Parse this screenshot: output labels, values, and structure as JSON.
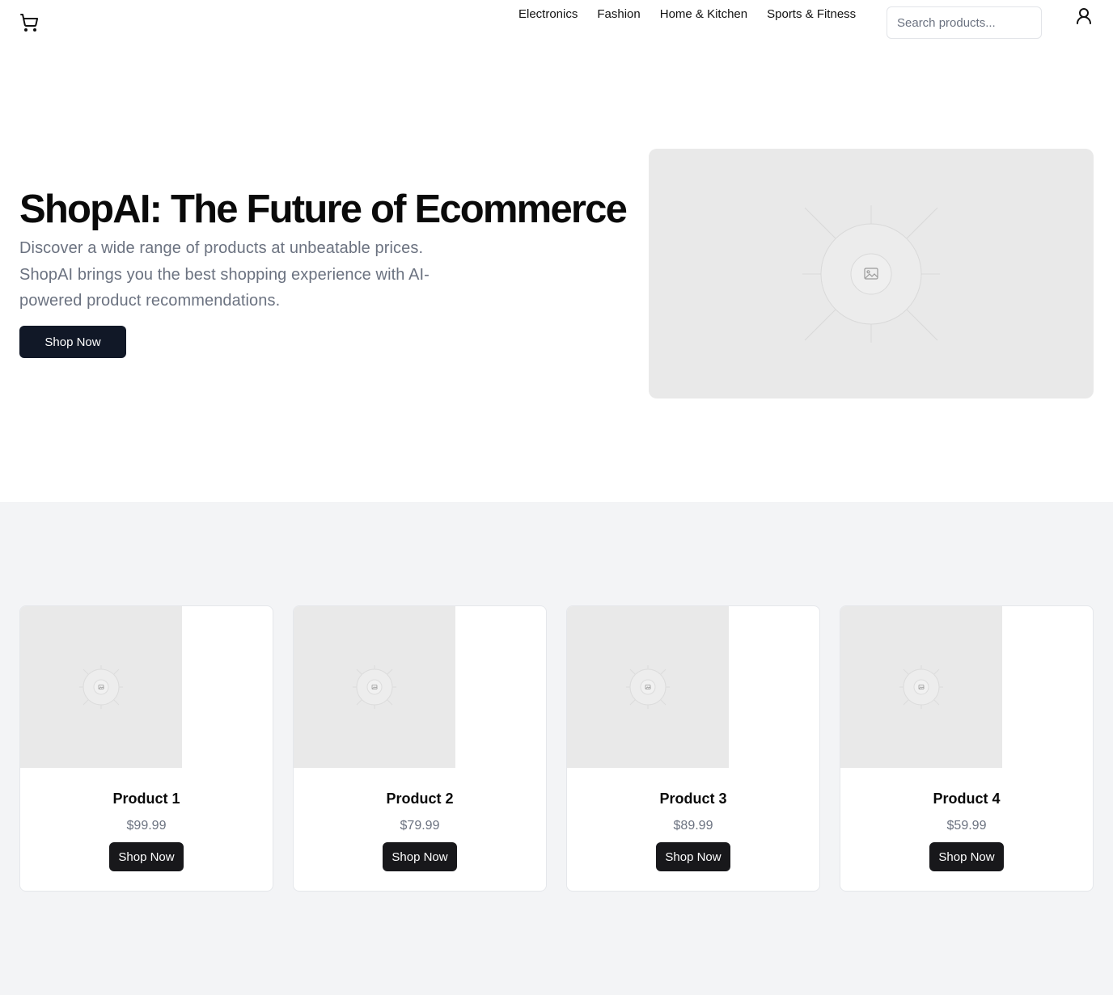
{
  "header": {
    "nav": [
      "Electronics",
      "Fashion",
      "Home & Kitchen",
      "Sports & Fitness"
    ],
    "search_placeholder": "Search products...",
    "icons": {
      "cart": "shopping-cart-icon",
      "user": "user-icon"
    }
  },
  "hero": {
    "title": "ShopAI: The Future of Ecommerce",
    "description": "Discover a wide range of products at unbeatable prices. ShopAI brings you the best shopping experience with AI-powered product recommendations.",
    "cta": "Shop Now",
    "image_icon": "image-placeholder-icon"
  },
  "products": [
    {
      "name": "Product 1",
      "price": "$99.99",
      "cta": "Shop Now"
    },
    {
      "name": "Product 2",
      "price": "$79.99",
      "cta": "Shop Now"
    },
    {
      "name": "Product 3",
      "price": "$89.99",
      "cta": "Shop Now"
    },
    {
      "name": "Product 4",
      "price": "$59.99",
      "cta": "Shop Now"
    }
  ],
  "colors": {
    "primary": "#111827",
    "muted_text": "#6b7280",
    "section_bg": "#f3f4f6",
    "placeholder_bg": "#e9e9e9"
  }
}
